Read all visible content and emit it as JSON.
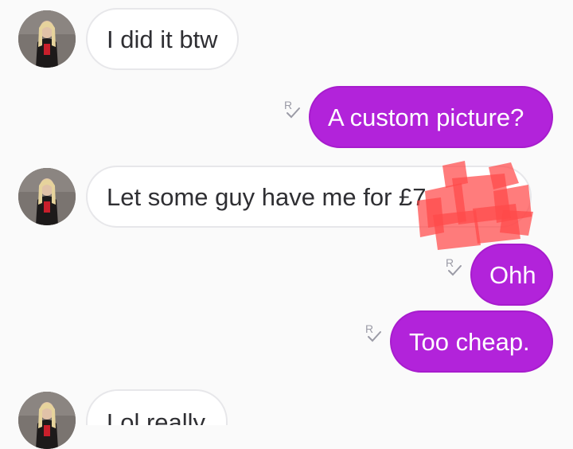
{
  "messages": [
    {
      "direction": "incoming",
      "text": "I did it btw"
    },
    {
      "direction": "outgoing",
      "text": "A custom picture?",
      "receipt": "R"
    },
    {
      "direction": "incoming",
      "text": "Let some guy have me for £7"
    },
    {
      "direction": "outgoing",
      "text": "Ohh",
      "receipt": "R"
    },
    {
      "direction": "outgoing",
      "text": "Too cheap.",
      "receipt": "R"
    },
    {
      "direction": "incoming",
      "text": "Lol really"
    }
  ],
  "colors": {
    "background": "#fafafa",
    "incoming_bubble": "#ffffff",
    "incoming_text": "#2f2f33",
    "outgoing_bubble": "#b223da",
    "outgoing_text": "#ffffff",
    "receipt": "#9b9ba6",
    "redaction": "#ff4a4a"
  }
}
